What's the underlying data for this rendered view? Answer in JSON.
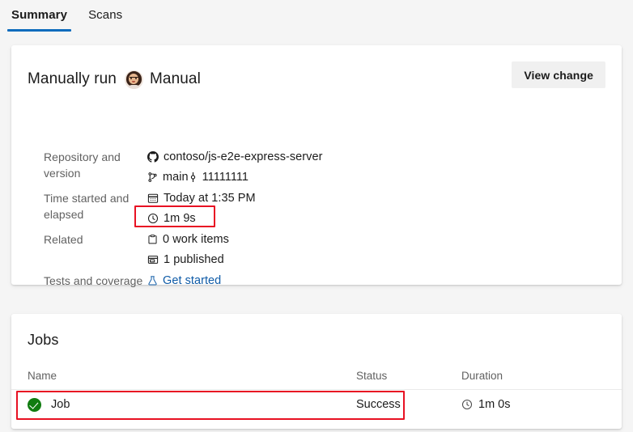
{
  "tabs": [
    {
      "label": "Summary",
      "active": true
    },
    {
      "label": "Scans",
      "active": false
    }
  ],
  "summary": {
    "title": "Manually run",
    "trigger": "Manual",
    "avatar_icon": "user-avatar",
    "view_change_label": "View change",
    "rows": [
      {
        "label": "Repository and version",
        "lines": [
          {
            "icon": "github-icon",
            "text": "contoso/js-e2e-express-server"
          },
          {
            "icon": "branch-icon",
            "text": "main",
            "icon2": "commit-icon",
            "text2": "11111111"
          }
        ]
      },
      {
        "label": "Time started and elapsed",
        "lines": [
          {
            "icon": "calendar-icon",
            "text": "Today at 1:35 PM"
          },
          {
            "icon": "clock-icon",
            "text": "1m 9s"
          }
        ]
      },
      {
        "label": "Related",
        "lines": [
          {
            "icon": "work-item-icon",
            "text": "0 work items"
          },
          {
            "icon": "artifact-icon",
            "text": "1 published",
            "highlighted": true
          }
        ]
      },
      {
        "label": "Tests and coverage",
        "lines": [
          {
            "icon": "beaker-icon",
            "text": "Get started",
            "link": true
          }
        ]
      }
    ]
  },
  "jobs": {
    "title": "Jobs",
    "columns": {
      "name": "Name",
      "status": "Status",
      "duration": "Duration"
    },
    "rows": [
      {
        "status_icon": "success-check-icon",
        "name": "Job",
        "status": "Success",
        "duration_icon": "clock-icon",
        "duration": "1m 0s",
        "highlighted": true
      }
    ]
  },
  "colors": {
    "accent": "#0f6cbd",
    "link": "#0f5ba7",
    "success": "#107c10",
    "annotation": "#e81123",
    "page_background": "#f5f5f5"
  }
}
